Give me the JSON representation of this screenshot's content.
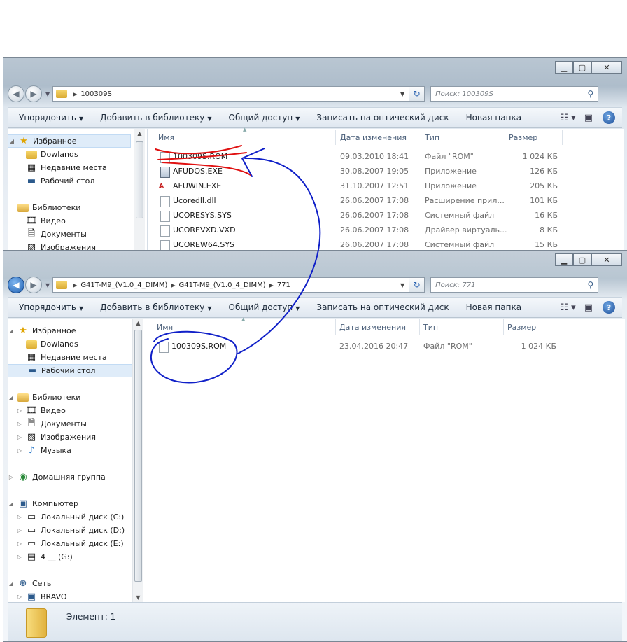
{
  "toolbar": {
    "organize": "Упорядочить",
    "add_to_library": "Добавить в библиотеку",
    "share": "Общий доступ",
    "burn": "Записать на оптический диск",
    "new_folder": "Новая папка"
  },
  "columns": {
    "name": "Имя",
    "date": "Дата изменения",
    "type": "Тип",
    "size": "Размер"
  },
  "window1": {
    "address": "100309S",
    "search_placeholder": "Поиск: 100309S",
    "nav": [
      {
        "label": "Избранное",
        "icon": "star-icon"
      },
      {
        "label": "Dowlands",
        "icon": "folder-icon"
      },
      {
        "label": "Недавние места",
        "icon": "recent-places-icon"
      },
      {
        "label": "Рабочий стол",
        "icon": "desktop-icon"
      },
      {
        "label": "Библиотеки",
        "icon": "libraries-icon"
      },
      {
        "label": "Видео",
        "icon": "video-icon"
      },
      {
        "label": "Документы",
        "icon": "documents-icon"
      },
      {
        "label": "Изображения",
        "icon": "pictures-icon"
      }
    ],
    "files": [
      {
        "name": "100309S.ROM",
        "date": "09.03.2010 18:41",
        "type": "Файл \"ROM\"",
        "size": "1 024 КБ",
        "icon": "file-icon"
      },
      {
        "name": "AFUDOS.EXE",
        "date": "30.08.2007 19:05",
        "type": "Приложение",
        "size": "126 КБ",
        "icon": "exe-icon"
      },
      {
        "name": "AFUWIN.EXE",
        "date": "31.10.2007 12:51",
        "type": "Приложение",
        "size": "205 КБ",
        "icon": "afuwin-icon"
      },
      {
        "name": "Ucoredll.dll",
        "date": "26.06.2007 17:08",
        "type": "Расширение прил...",
        "size": "101 КБ",
        "icon": "file-icon"
      },
      {
        "name": "UCORESYS.SYS",
        "date": "26.06.2007 17:08",
        "type": "Системный файл",
        "size": "16 КБ",
        "icon": "file-icon"
      },
      {
        "name": "UCOREVXD.VXD",
        "date": "26.06.2007 17:08",
        "type": "Драйвер виртуаль...",
        "size": "8 КБ",
        "icon": "file-icon"
      },
      {
        "name": "UCOREW64.SYS",
        "date": "26.06.2007 17:08",
        "type": "Системный файл",
        "size": "15 КБ",
        "icon": "file-icon"
      }
    ]
  },
  "window2": {
    "address_segments": [
      "G41T-M9_(V1.0_4_DIMM)",
      "G41T-M9_(V1.0_4_DIMM)",
      "771"
    ],
    "search_placeholder": "Поиск: 771",
    "nav": [
      {
        "label": "Избранное",
        "icon": "star-icon"
      },
      {
        "label": "Dowlands",
        "icon": "folder-icon"
      },
      {
        "label": "Недавние места",
        "icon": "recent-places-icon"
      },
      {
        "label": "Рабочий стол",
        "icon": "desktop-icon"
      },
      {
        "label": "Библиотеки",
        "icon": "libraries-icon"
      },
      {
        "label": "Видео",
        "icon": "video-icon"
      },
      {
        "label": "Документы",
        "icon": "documents-icon"
      },
      {
        "label": "Изображения",
        "icon": "pictures-icon"
      },
      {
        "label": "Музыка",
        "icon": "music-icon"
      },
      {
        "label": "Домашняя группа",
        "icon": "homegroup-icon"
      },
      {
        "label": "Компьютер",
        "icon": "computer-icon"
      },
      {
        "label": "Локальный диск (C:)",
        "icon": "drive-c-icon"
      },
      {
        "label": "Локальный диск (D:)",
        "icon": "drive-icon"
      },
      {
        "label": "Локальный диск (E:)",
        "icon": "drive-icon"
      },
      {
        "label": "4 __ (G:)",
        "icon": "removable-drive-icon"
      },
      {
        "label": "Сеть",
        "icon": "network-icon"
      },
      {
        "label": "BRAVO",
        "icon": "network-computer-icon"
      }
    ],
    "files": [
      {
        "name": "100309S.ROM",
        "date": "23.04.2016 20:47",
        "type": "Файл \"ROM\"",
        "size": "1 024 КБ",
        "icon": "file-icon"
      }
    ],
    "status": "Элемент: 1"
  },
  "colors": {
    "ink_blue": "#1020c8",
    "ink_red": "#e01010",
    "selection": "#dfecf9"
  }
}
